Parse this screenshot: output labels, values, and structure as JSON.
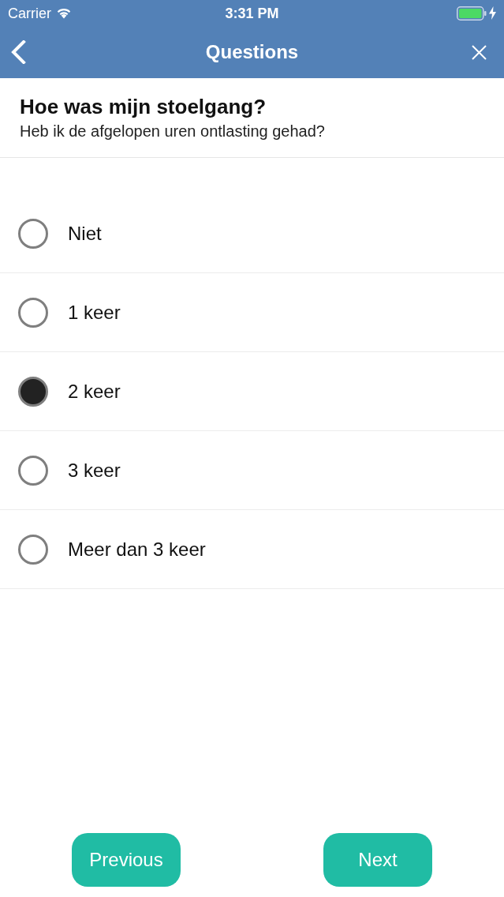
{
  "status_bar": {
    "carrier": "Carrier",
    "time": "3:31 PM"
  },
  "nav_bar": {
    "title": "Questions"
  },
  "question": {
    "title": "Hoe was mijn stoelgang?",
    "subtitle": "Heb ik de afgelopen uren ontlasting gehad?"
  },
  "options": [
    {
      "label": "Niet",
      "selected": false
    },
    {
      "label": "1 keer",
      "selected": false
    },
    {
      "label": "2 keer",
      "selected": true
    },
    {
      "label": "3 keer",
      "selected": false
    },
    {
      "label": "Meer dan 3 keer",
      "selected": false
    }
  ],
  "buttons": [
    {
      "label": "Previous"
    },
    {
      "label": "Next"
    }
  ]
}
